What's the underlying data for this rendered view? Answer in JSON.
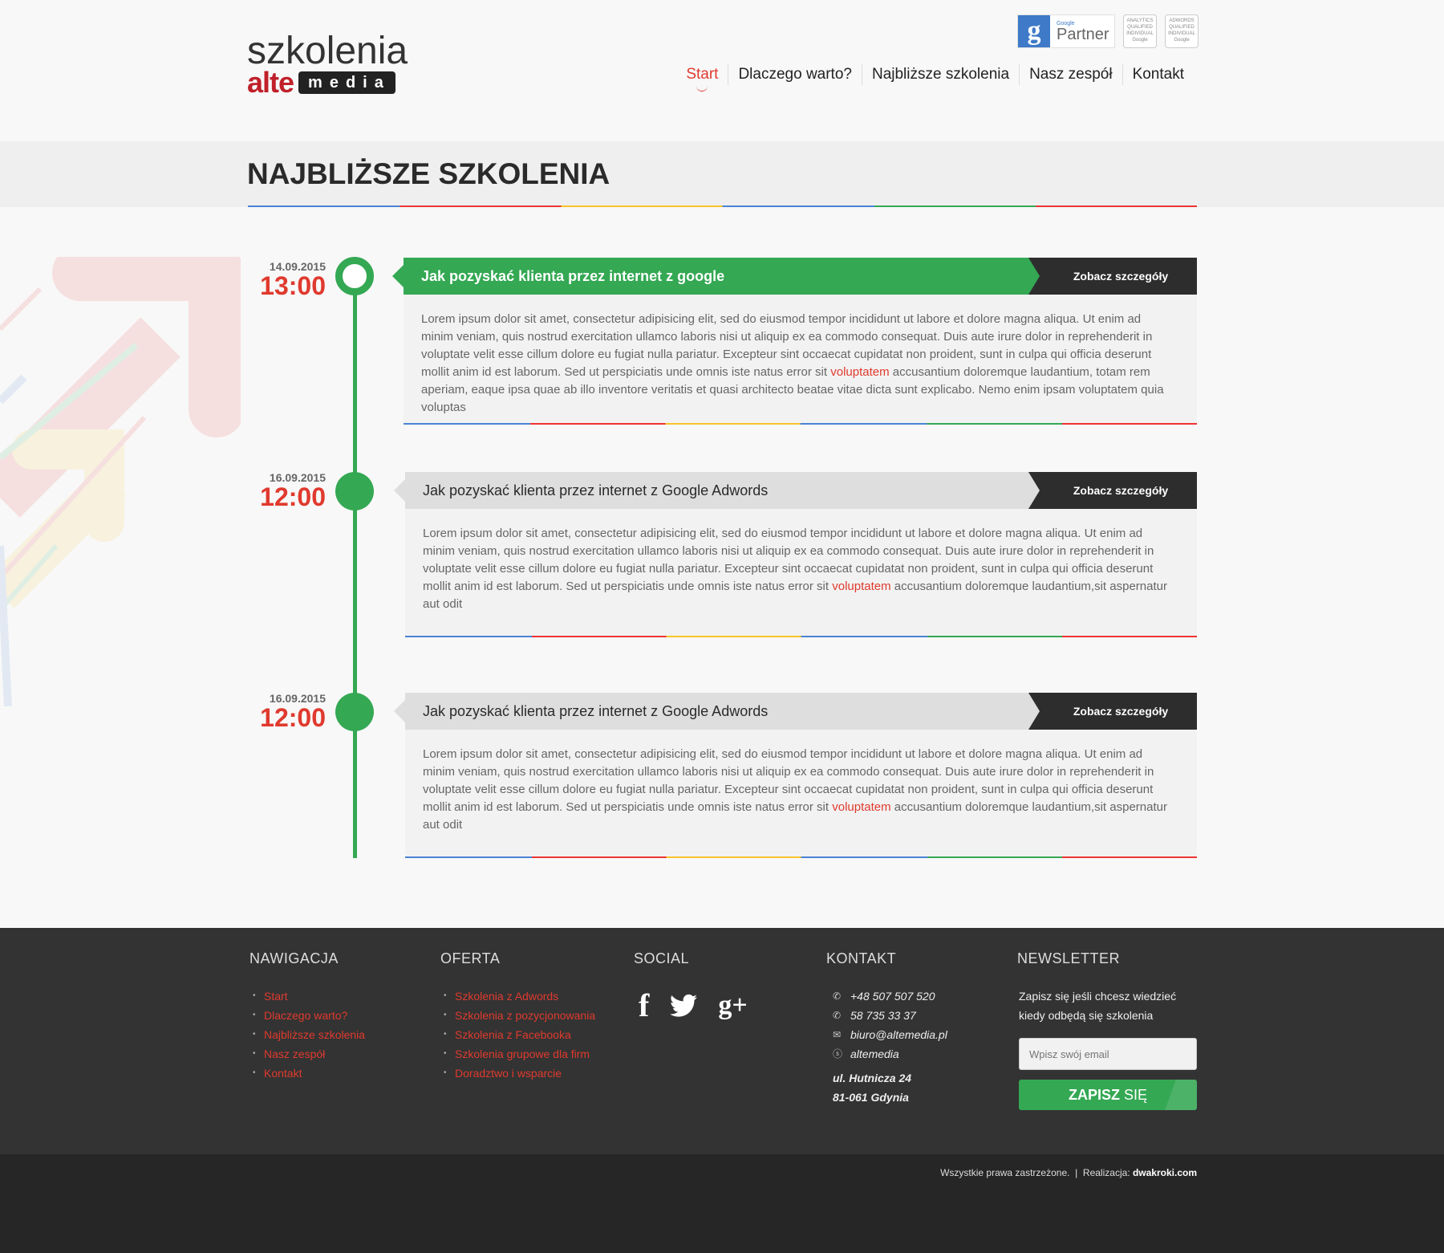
{
  "header": {
    "logo_top": "szkolenia",
    "logo_alte": "alte",
    "logo_media": "media",
    "badge_partner_small": "Google",
    "badge_partner_big": "Partner",
    "badge_analytics": "ANALYTICS QUALIFIED INDIVIDUAL Google",
    "badge_adwords": "ADWORDS QUALIFIED INDIVIDUAL Google",
    "nav": [
      "Start",
      "Dlaczego warto?",
      "Najbliższe szkolenia",
      "Nasz zespół",
      "Kontakt"
    ]
  },
  "page_title": "NAJBLIŻSZE SZKOLENIA",
  "events": [
    {
      "date": "14.09.2015",
      "time": "13:00",
      "title": "Jak pozyskać klienta przez internet z google",
      "button": "Zobacz szczegóły",
      "text_before": "Lorem ipsum dolor sit amet, consectetur adipisicing elit, sed do eiusmod tempor incididunt ut labore et dolore magna aliqua. Ut enim ad minim veniam, quis nostrud exercitation ullamco laboris nisi ut aliquip ex ea commodo consequat. Duis aute irure dolor in reprehenderit in voluptate velit esse cillum dolore eu fugiat nulla pariatur. Excepteur sint occaecat cupidatat non proident, sunt in culpa qui officia deserunt mollit anim id est laborum. Sed ut perspiciatis unde omnis iste natus error sit ",
      "highlight": "voluptatem",
      "text_after": " accusantium doloremque laudantium, totam rem aperiam, eaque ipsa quae ab illo inventore veritatis et quasi architecto beatae vitae dicta sunt explicabo. Nemo enim ipsam voluptatem quia voluptas"
    },
    {
      "date": "16.09.2015",
      "time": "12:00",
      "title": "Jak pozyskać klienta przez internet z Google Adwords",
      "button": "Zobacz szczegóły",
      "text_before": "Lorem ipsum dolor sit amet, consectetur adipisicing elit, sed do eiusmod tempor incididunt ut labore et dolore magna aliqua. Ut enim ad minim veniam, quis nostrud exercitation ullamco laboris nisi ut aliquip ex ea commodo consequat. Duis aute irure dolor in reprehenderit in voluptate velit esse cillum dolore eu fugiat nulla pariatur. Excepteur sint occaecat cupidatat non proident, sunt in culpa qui officia deserunt mollit anim id est laborum. Sed ut perspiciatis unde omnis iste natus error sit ",
      "highlight": "voluptatem",
      "text_after": " accusantium doloremque laudantium,sit aspernatur aut odit"
    },
    {
      "date": "16.09.2015",
      "time": "12:00",
      "title": "Jak pozyskać klienta przez internet z Google Adwords",
      "button": "Zobacz szczegóły",
      "text_before": "Lorem ipsum dolor sit amet, consectetur adipisicing elit, sed do eiusmod tempor incididunt ut labore et dolore magna aliqua. Ut enim ad minim veniam, quis nostrud exercitation ullamco laboris nisi ut aliquip ex ea commodo consequat. Duis aute irure dolor in reprehenderit in voluptate velit esse cillum dolore eu fugiat nulla pariatur. Excepteur sint occaecat cupidatat non proident, sunt in culpa qui officia deserunt mollit anim id est laborum. Sed ut perspiciatis unde omnis iste natus error sit ",
      "highlight": "voluptatem",
      "text_after": " accusantium doloremque laudantium,sit aspernatur aut odit"
    }
  ],
  "footer": {
    "nav_heading": "NAWIGACJA",
    "nav_items": [
      "Start",
      "Dlaczego warto?",
      "Najbliższe szkolenia",
      "Nasz zespół",
      "Kontakt"
    ],
    "offer_heading": "OFERTA",
    "offer_items": [
      "Szkolenia z Adwords",
      "Szkolenia z pozycjonowania",
      "Szkolenia z Facebooka",
      "Szkolenia grupowe dla firm",
      "Doradztwo i wsparcie"
    ],
    "social_heading": "SOCIAL",
    "social_icons": [
      "f",
      "t",
      "g+"
    ],
    "contact_heading": "KONTAKT",
    "phone1": "+48 507 507 520",
    "phone2": "58 735 33 37",
    "email": "biuro@altemedia.pl",
    "skype": "altemedia",
    "address1": "ul. Hutnicza 24",
    "address2": "81-061 Gdynia",
    "newsletter_heading": "NEWSLETTER",
    "newsletter_text": "Zapisz się jeśli chcesz wiedzieć kiedy odbędą się szkolenia",
    "newsletter_placeholder": "Wpisz swój email",
    "newsletter_button_bold": "ZAPISZ",
    "newsletter_button_rest": " SIĘ"
  },
  "bottom": {
    "copyright": "Wszystkie prawa zastrzeżone.",
    "separator": "|",
    "realization_label": "Realizacja:",
    "realization_link": "dwakroki.com"
  },
  "colors": {
    "accent_red": "#e03a2e",
    "accent_green": "#34a853",
    "dark": "#2d2d2d"
  }
}
